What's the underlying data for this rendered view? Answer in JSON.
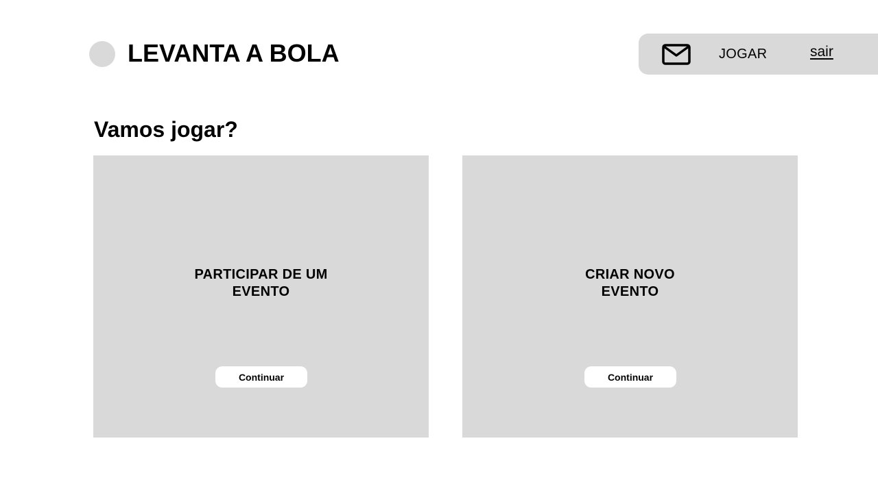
{
  "header": {
    "brand_name": "LEVANTA A BOLA",
    "logo_icon": "circle-logo-icon",
    "nav": {
      "mail_icon": "envelope-icon",
      "play_label": "JOGAR",
      "exit_label": "sair"
    }
  },
  "main": {
    "title": "Vamos jogar?",
    "cards": [
      {
        "title": "PARTICIPAR DE UM EVENTO",
        "button_label": "Continuar"
      },
      {
        "title": "CRIAR NOVO EVENTO",
        "button_label": "Continuar"
      }
    ]
  },
  "colors": {
    "background": "#ffffff",
    "panel": "#d9d9d9",
    "text": "#000000",
    "button": "#ffffff"
  }
}
